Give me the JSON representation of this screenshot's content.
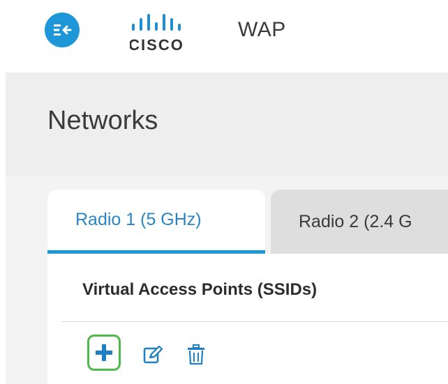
{
  "header": {
    "menu_icon": "collapse-menu-icon",
    "logo_icon": "cisco-logo-icon",
    "logo_text": "CISCO",
    "product_name": "WAP"
  },
  "page": {
    "title": "Networks"
  },
  "tabs": [
    {
      "label": "Radio 1 (5 GHz)",
      "active": true
    },
    {
      "label": "Radio 2 (2.4 G",
      "active": false
    }
  ],
  "section": {
    "heading": "Virtual Access Points (SSIDs)"
  },
  "toolbar": {
    "add_icon": "plus-icon",
    "edit_icon": "edit-icon",
    "delete_icon": "trash-icon"
  },
  "colors": {
    "accent_blue": "#1e97d8",
    "active_tab_text": "#2b85c4",
    "add_highlight": "#4fb84a",
    "band_gray": "#eeeeee",
    "inactive_tab": "#dedede"
  }
}
